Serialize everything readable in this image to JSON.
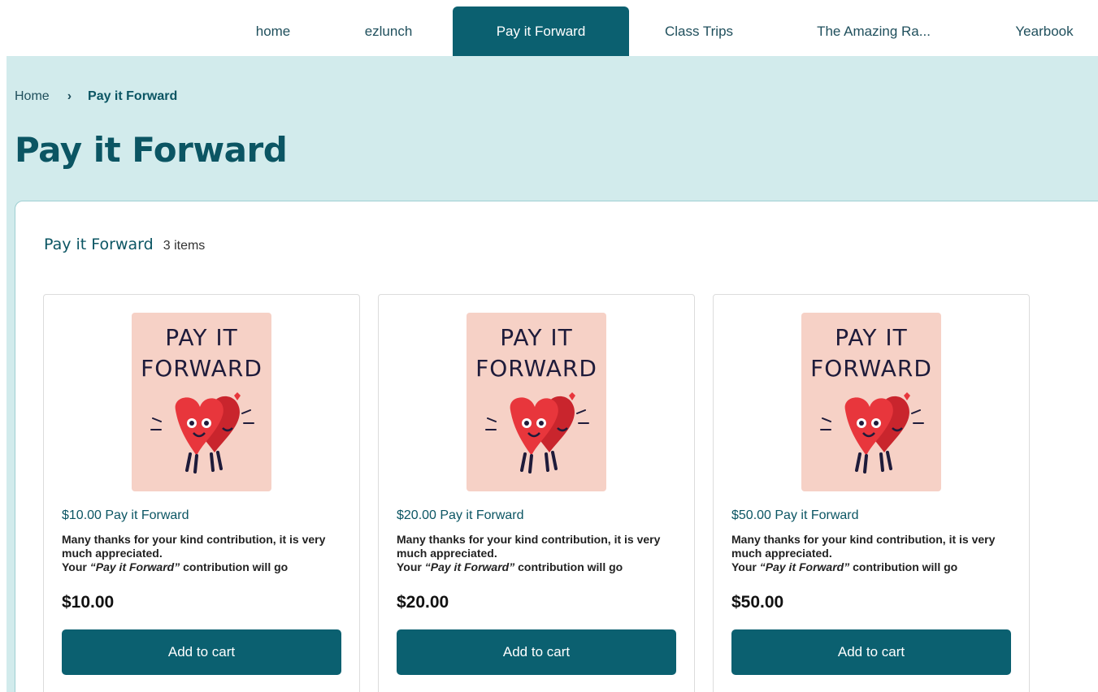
{
  "nav": {
    "tabs": [
      {
        "label": "home",
        "active": false
      },
      {
        "label": "ezlunch",
        "active": false
      },
      {
        "label": "Pay it Forward",
        "active": true
      },
      {
        "label": "Class Trips",
        "active": false
      },
      {
        "label": "The Amazing Ra...",
        "active": false
      },
      {
        "label": "Yearbook",
        "active": false
      }
    ]
  },
  "breadcrumb": {
    "home": "Home",
    "separator": "›",
    "current": "Pay it Forward"
  },
  "page": {
    "title": "Pay it Forward"
  },
  "panel": {
    "title": "Pay it Forward",
    "count": "3 items"
  },
  "products": [
    {
      "image_line1": "PAY IT",
      "image_line2": "FORWARD",
      "name": "$10.00 Pay it Forward",
      "desc_line1": "Many thanks for your kind contribution, it is very much appreciated.",
      "desc_prefix": "Your ",
      "desc_em": "“Pay it Forward”",
      "desc_suffix": " contribution will go",
      "price": "$10.00",
      "button": "Add to cart"
    },
    {
      "image_line1": "PAY IT",
      "image_line2": "FORWARD",
      "name": "$20.00 Pay it Forward",
      "desc_line1": "Many thanks for your kind contribution, it is very much appreciated.",
      "desc_prefix": "Your ",
      "desc_em": "“Pay it Forward”",
      "desc_suffix": " contribution will go",
      "price": "$20.00",
      "button": "Add to cart"
    },
    {
      "image_line1": "PAY IT",
      "image_line2": "FORWARD",
      "name": "$50.00 Pay it Forward",
      "desc_line1": "Many thanks for your kind contribution, it is very much appreciated.",
      "desc_prefix": "Your ",
      "desc_em": "“Pay it Forward”",
      "desc_suffix": " contribution will go",
      "price": "$50.00",
      "button": "Add to cart"
    }
  ],
  "colors": {
    "brand": "#0b6070",
    "band": "#d2ebec",
    "title": "#0b5563",
    "image_bg": "#f6d1c6",
    "heart_red": "#e8363c"
  }
}
